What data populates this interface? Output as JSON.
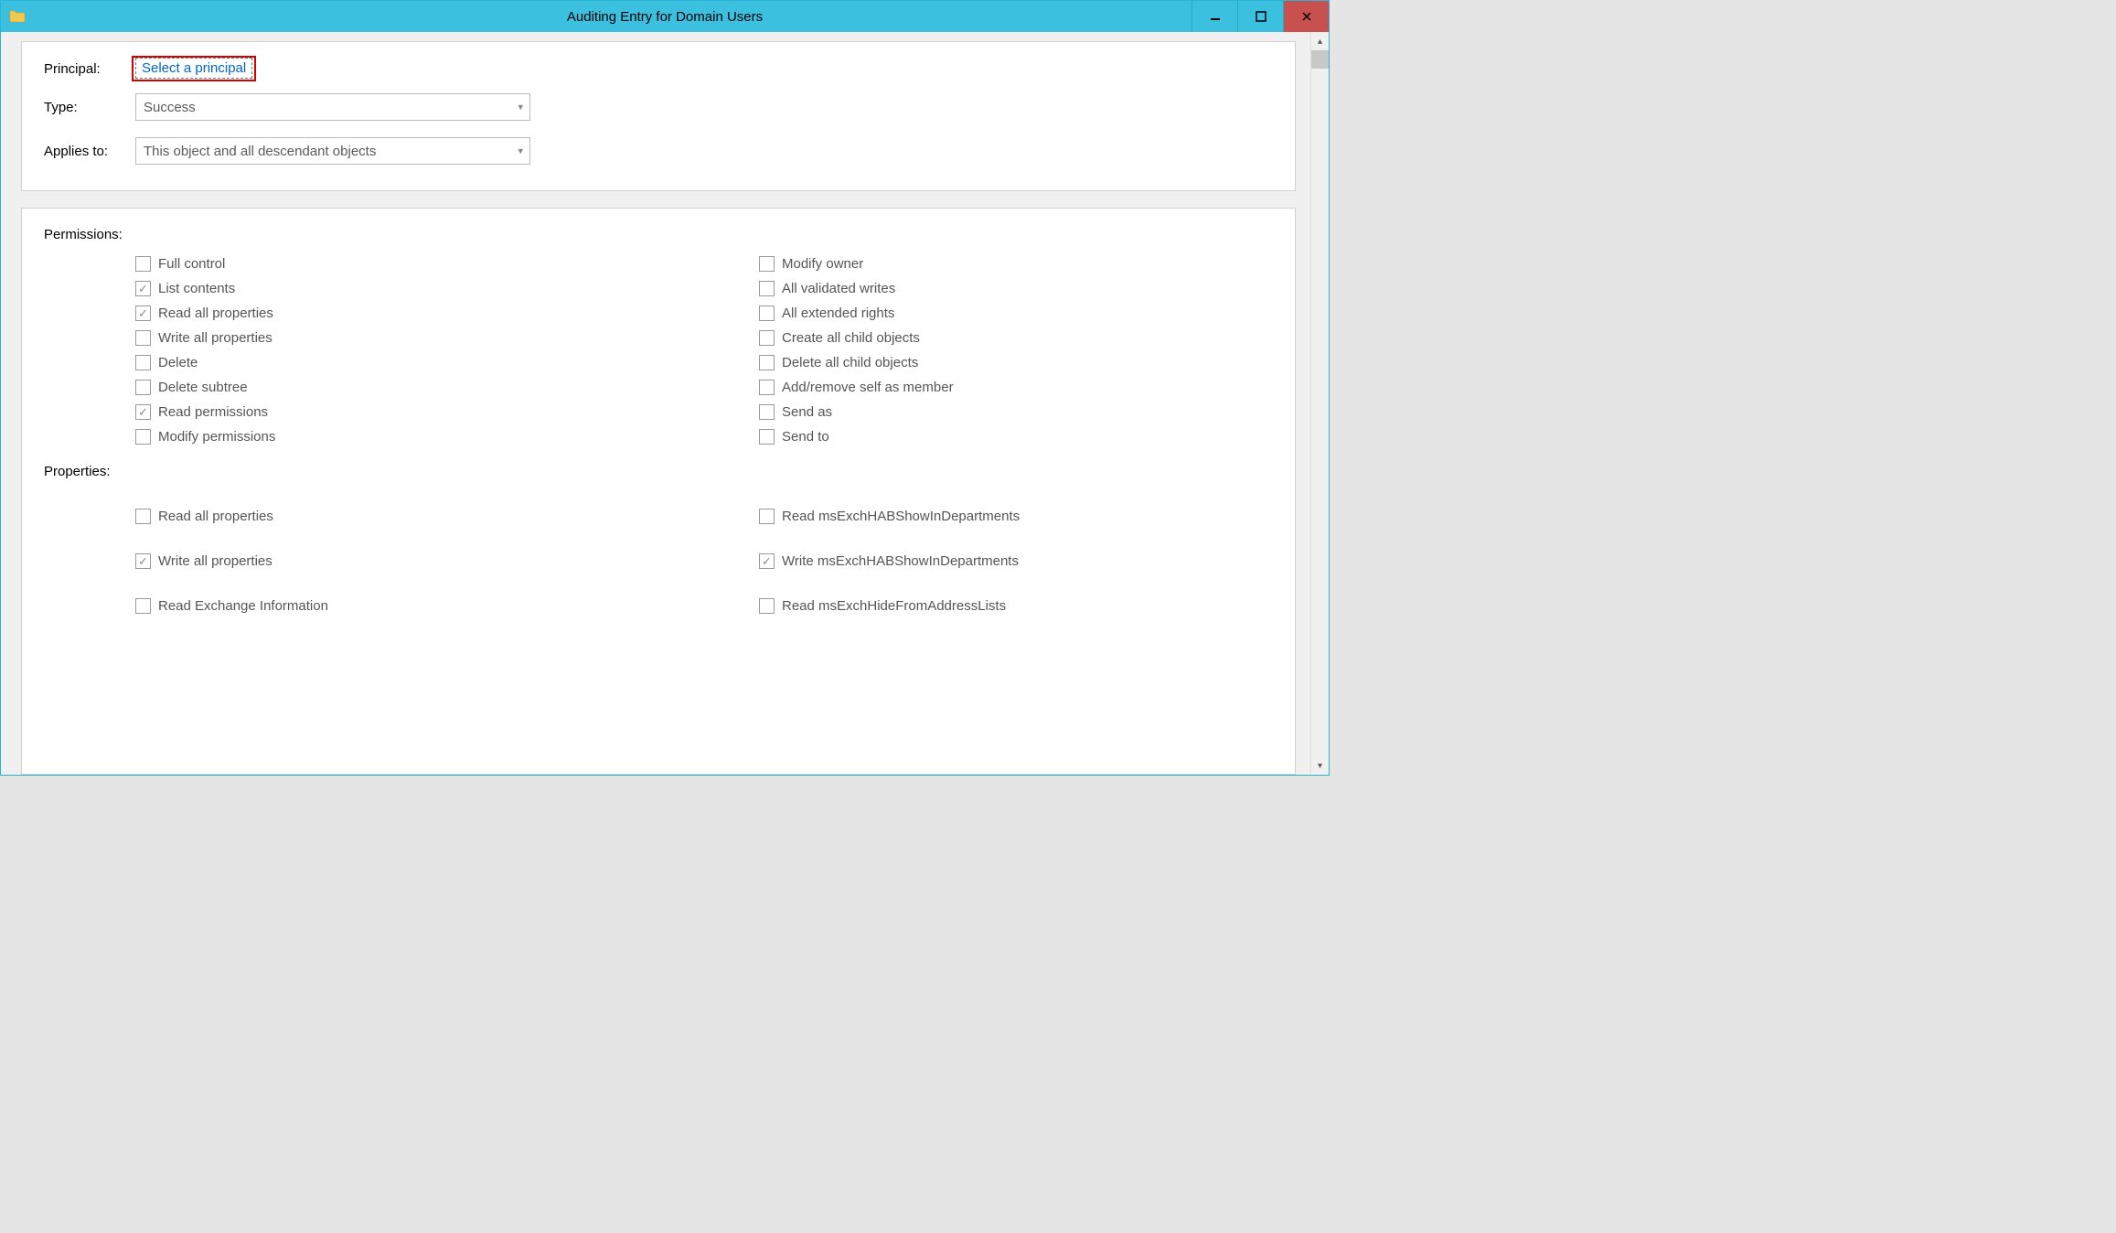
{
  "window": {
    "title": "Auditing Entry for Domain Users"
  },
  "form": {
    "principal_label": "Principal:",
    "principal_link": "Select a principal",
    "type_label": "Type:",
    "type_value": "Success",
    "applies_label": "Applies to:",
    "applies_value": "This object and all descendant objects"
  },
  "permissions": {
    "title": "Permissions:",
    "left": [
      {
        "label": "Full control",
        "checked": false
      },
      {
        "label": "List contents",
        "checked": true
      },
      {
        "label": "Read all properties",
        "checked": true
      },
      {
        "label": "Write all properties",
        "checked": false
      },
      {
        "label": "Delete",
        "checked": false
      },
      {
        "label": "Delete subtree",
        "checked": false
      },
      {
        "label": "Read permissions",
        "checked": true
      },
      {
        "label": "Modify permissions",
        "checked": false
      }
    ],
    "right": [
      {
        "label": "Modify owner",
        "checked": false
      },
      {
        "label": "All validated writes",
        "checked": false
      },
      {
        "label": "All extended rights",
        "checked": false
      },
      {
        "label": "Create all child objects",
        "checked": false
      },
      {
        "label": "Delete all child objects",
        "checked": false
      },
      {
        "label": "Add/remove self as member",
        "checked": false
      },
      {
        "label": "Send as",
        "checked": false
      },
      {
        "label": "Send to",
        "checked": false
      }
    ]
  },
  "properties": {
    "title": "Properties:",
    "left": [
      {
        "label": "Read all properties",
        "checked": false
      },
      {
        "label": "Write all properties",
        "checked": true
      },
      {
        "label": "Read Exchange Information",
        "checked": false
      }
    ],
    "right": [
      {
        "label": "Read msExchHABShowInDepartments",
        "checked": false
      },
      {
        "label": "Write msExchHABShowInDepartments",
        "checked": true
      },
      {
        "label": "Read msExchHideFromAddressLists",
        "checked": false
      }
    ]
  },
  "highlight": {
    "target": "principal-link"
  }
}
